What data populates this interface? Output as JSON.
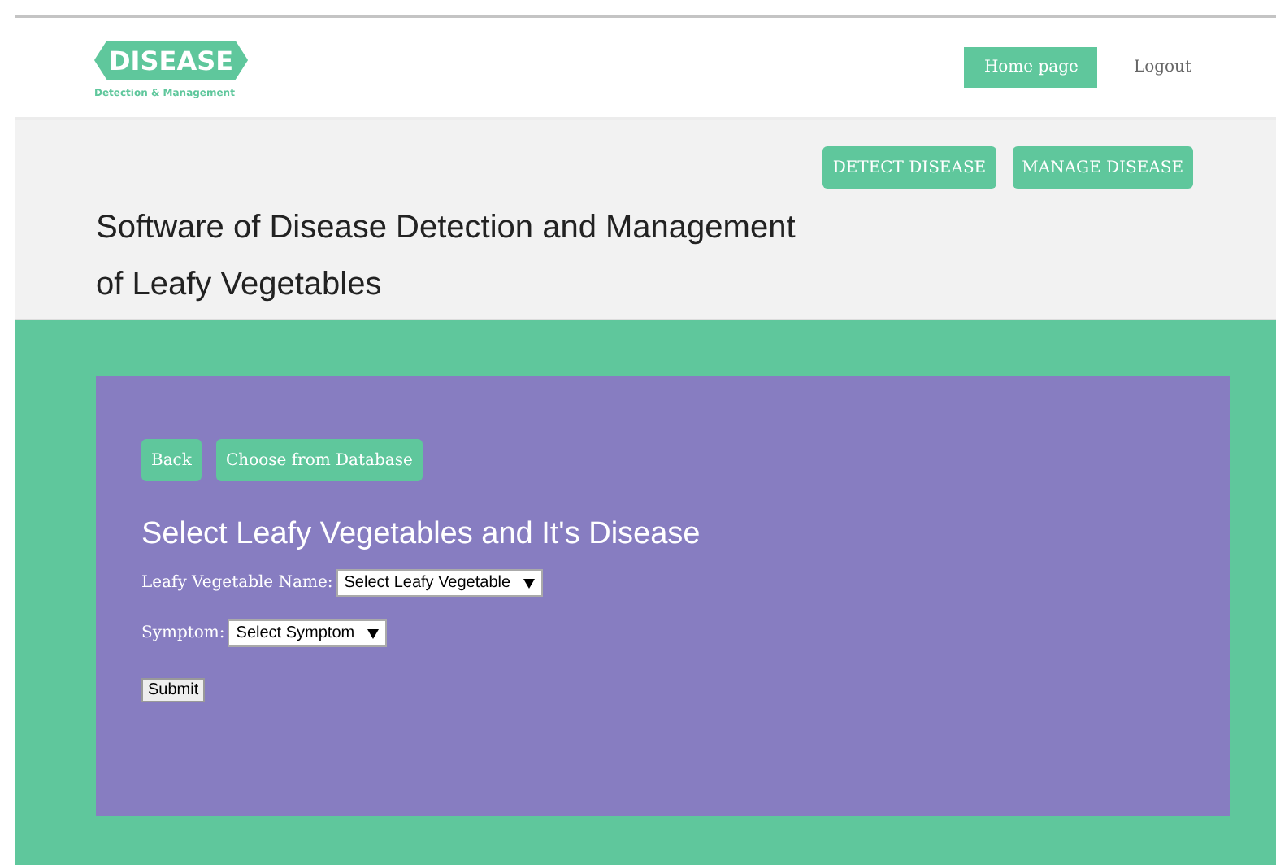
{
  "header": {
    "logo": {
      "title": "DISEASE",
      "subtitle": "Detection & Management"
    },
    "nav": [
      {
        "label": "Home page",
        "selected": true
      },
      {
        "label": "Logout",
        "selected": false
      }
    ]
  },
  "hero": {
    "actions": [
      "DETECT DISEASE",
      "MANAGE DISEASE"
    ],
    "title": "Software of Disease Detection and Management of Leafy Vegetables"
  },
  "panel": {
    "buttons": [
      "Back",
      "Choose from Database"
    ],
    "heading": "Select Leafy Vegetables and It's Disease",
    "fields": [
      {
        "label": "Leafy Vegetable Name:",
        "value": "Select Leafy Vegetable"
      },
      {
        "label": "Symptom:",
        "value": "Select Symptom"
      }
    ],
    "submit": "Submit"
  }
}
